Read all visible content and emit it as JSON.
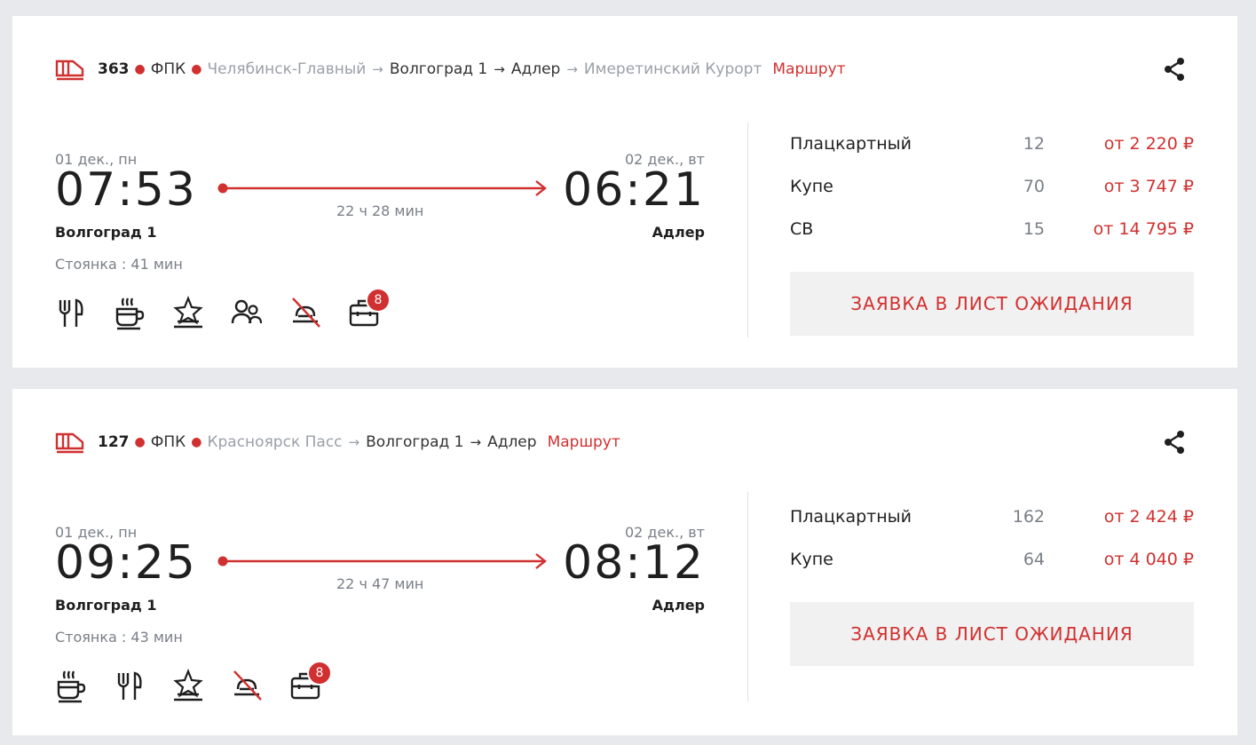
{
  "cards": [
    {
      "train_number": "363",
      "carrier": "ФПК",
      "stations": [
        {
          "name": "Челябинск-Главный",
          "style": "grey"
        },
        {
          "name": "Волгоград 1",
          "style": "dark"
        },
        {
          "name": "Адлер",
          "style": "dark"
        },
        {
          "name": "Имеретинский Курорт",
          "style": "grey"
        }
      ],
      "route_label": "Маршрут",
      "dep_date": "01 дек., пн",
      "dep_time": "07:53",
      "dep_station": "Волгоград 1",
      "arr_date": "02 дек., вт",
      "arr_time": "06:21",
      "arr_station": "Адлер",
      "duration": "22 ч 28 мин",
      "stop": "Стоянка : 41 мин",
      "amenities": [
        "restaurant-icon",
        "coffee-icon",
        "star-service-icon",
        "passengers-icon",
        "no-pets-icon",
        "luggage-icon"
      ],
      "luggage_badge": "8",
      "classes": [
        {
          "name": "Плацкартный",
          "seats": "12",
          "price": "от 2 220 ₽"
        },
        {
          "name": "Купе",
          "seats": "70",
          "price": "от 3 747 ₽"
        },
        {
          "name": "СВ",
          "seats": "15",
          "price": "от 14 795 ₽"
        }
      ],
      "wait_label": "ЗАЯВКА В ЛИСТ ОЖИДАНИЯ"
    },
    {
      "train_number": "127",
      "carrier": "ФПК",
      "stations": [
        {
          "name": "Красноярск Пасс",
          "style": "grey"
        },
        {
          "name": "Волгоград 1",
          "style": "dark"
        },
        {
          "name": "Адлер",
          "style": "dark"
        }
      ],
      "route_label": "Маршрут",
      "dep_date": "01 дек., пн",
      "dep_time": "09:25",
      "dep_station": "Волгоград 1",
      "arr_date": "02 дек., вт",
      "arr_time": "08:12",
      "arr_station": "Адлер",
      "duration": "22 ч 47 мин",
      "stop": "Стоянка : 43 мин",
      "amenities": [
        "coffee-icon",
        "restaurant-icon",
        "star-service-icon",
        "no-pets-icon",
        "luggage-icon"
      ],
      "luggage_badge": "8",
      "classes": [
        {
          "name": "Плацкартный",
          "seats": "162",
          "price": "от 2 424 ₽"
        },
        {
          "name": "Купе",
          "seats": "64",
          "price": "от 4 040 ₽"
        }
      ],
      "wait_label": "ЗАЯВКА В ЛИСТ ОЖИДАНИЯ"
    }
  ],
  "colors": {
    "accent": "#d0302f",
    "muted": "#7a7f87",
    "background": "#e8e9ed"
  }
}
